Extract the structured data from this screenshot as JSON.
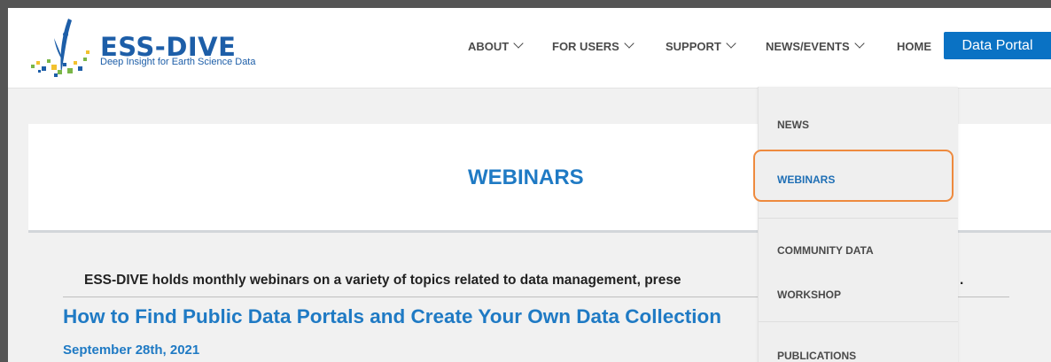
{
  "header": {
    "logo": {
      "title": "ESS-DIVE",
      "tagline": "Deep Insight for Earth Science Data",
      "icon": "ess-dive-logo-icon"
    },
    "nav": [
      {
        "label": "ABOUT",
        "has_dropdown": true
      },
      {
        "label": "FOR USERS",
        "has_dropdown": true
      },
      {
        "label": "SUPPORT",
        "has_dropdown": true
      },
      {
        "label": "NEWS/EVENTS",
        "has_dropdown": true
      },
      {
        "label": "HOME",
        "has_dropdown": false
      }
    ],
    "portal_button": "Data Portal"
  },
  "dropdown": {
    "items": [
      "NEWS",
      "WEBINARS",
      "COMMUNITY DATA",
      "WORKSHOP",
      "PUBLICATIONS"
    ],
    "active": "WEBINARS"
  },
  "page": {
    "title": "WEBINARS",
    "intro": "ESS-DIVE holds monthly webinars on a variety of topics related to data management, prese",
    "intro_end": "."
  },
  "article": {
    "title": "How to Find Public Data Portals and Create Your Own Data Collection",
    "date": "September 28th, 2021"
  },
  "colors": {
    "brand_blue": "#1d5ea8",
    "link_blue": "#1f7ac4",
    "button_blue": "#0a72c4",
    "highlight_orange": "#ee8a3e"
  }
}
